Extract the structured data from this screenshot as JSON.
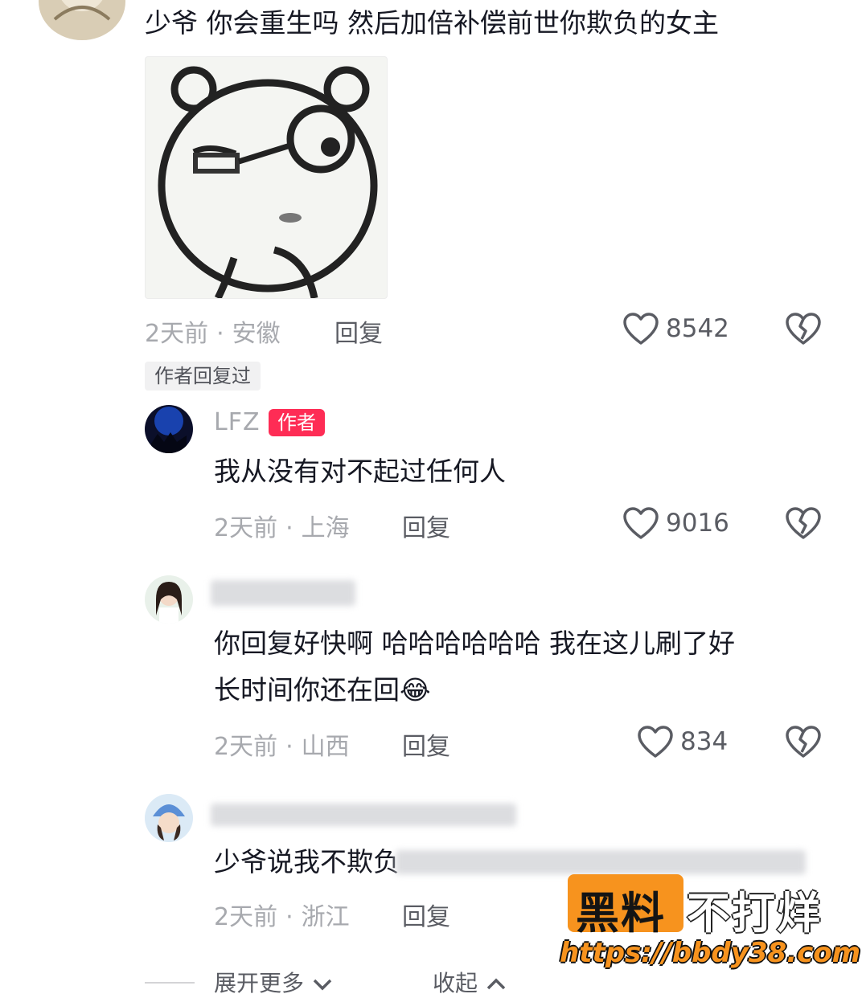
{
  "comments": [
    {
      "text": "少爷 你会重生吗 然后加倍补偿前世你欺负的女主",
      "time": "2天前",
      "location": "安徽",
      "reply_label": "回复",
      "likes": "8542",
      "author_replied_tag": "作者回复过"
    },
    {
      "username": "LFZ",
      "badge": "作者",
      "text": "我从没有对不起过任何人",
      "time": "2天前",
      "location": "上海",
      "reply_label": "回复",
      "likes": "9016"
    },
    {
      "text_line1": "你回复好快啊 哈哈哈哈哈哈 我在这儿刷了好",
      "text_line2": "长时间你还在回",
      "emoji": "😂",
      "time": "2天前",
      "location": "山西",
      "reply_label": "回复",
      "likes": "834"
    },
    {
      "text": "少爷说我不欺负",
      "time": "2天前",
      "location": "浙江",
      "reply_label": "回复"
    }
  ],
  "meta_separator": "·",
  "footer": {
    "expand_label": "展开更多",
    "collapse_label": "收起"
  },
  "watermark": {
    "left": "黑料",
    "right": "不打烊",
    "url": "https://bbdy38.com"
  }
}
